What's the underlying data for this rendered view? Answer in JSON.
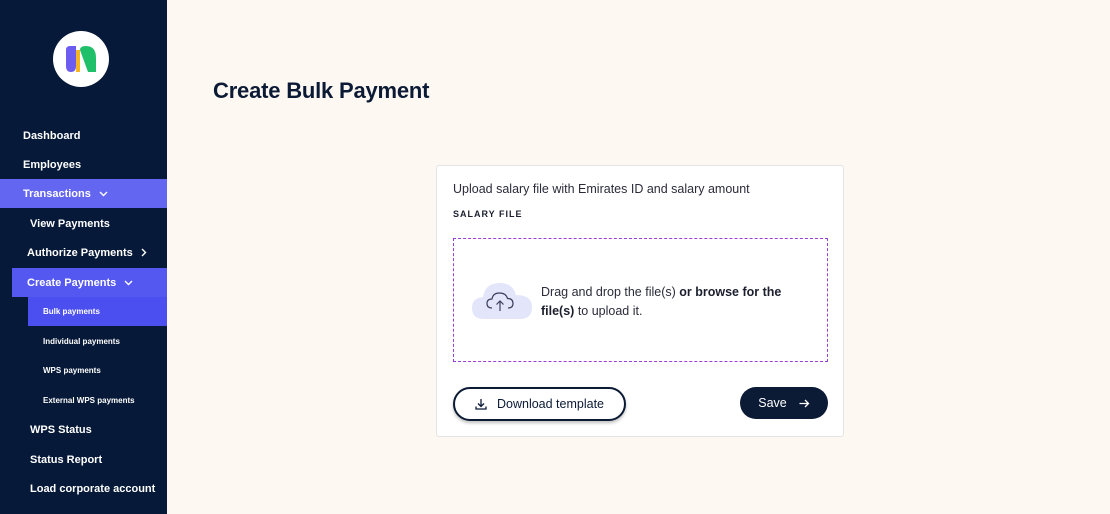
{
  "sidebar": {
    "items": [
      {
        "label": "Dashboard"
      },
      {
        "label": "Employees"
      },
      {
        "label": "Transactions"
      },
      {
        "label": "View Payments"
      },
      {
        "label": "Authorize Payments"
      },
      {
        "label": "Create Payments"
      },
      {
        "label": "Bulk payments"
      },
      {
        "label": "Individual payments"
      },
      {
        "label": "WPS payments"
      },
      {
        "label": "External WPS payments"
      },
      {
        "label": "WPS Status"
      },
      {
        "label": "Status Report"
      },
      {
        "label": "Load corporate account"
      }
    ]
  },
  "page": {
    "title": "Create Bulk Payment"
  },
  "card": {
    "description": "Upload salary file with Emirates ID and salary amount",
    "label": "SALARY FILE",
    "drop_text_prefix": "Drag and drop the file(s) ",
    "drop_text_bold": "or browse for the file(s)",
    "drop_text_suffix": " to upload it.",
    "download_label": "Download template",
    "save_label": "Save"
  },
  "colors": {
    "sidebar_bg": "#061938",
    "active_transactions": "#6366f1",
    "active_create": "#5558f0",
    "active_bulk": "#4c4ff0",
    "primary_dark": "#0b1a35",
    "dropzone_border": "#9b3fd2",
    "page_bg": "#fdf8f2"
  }
}
